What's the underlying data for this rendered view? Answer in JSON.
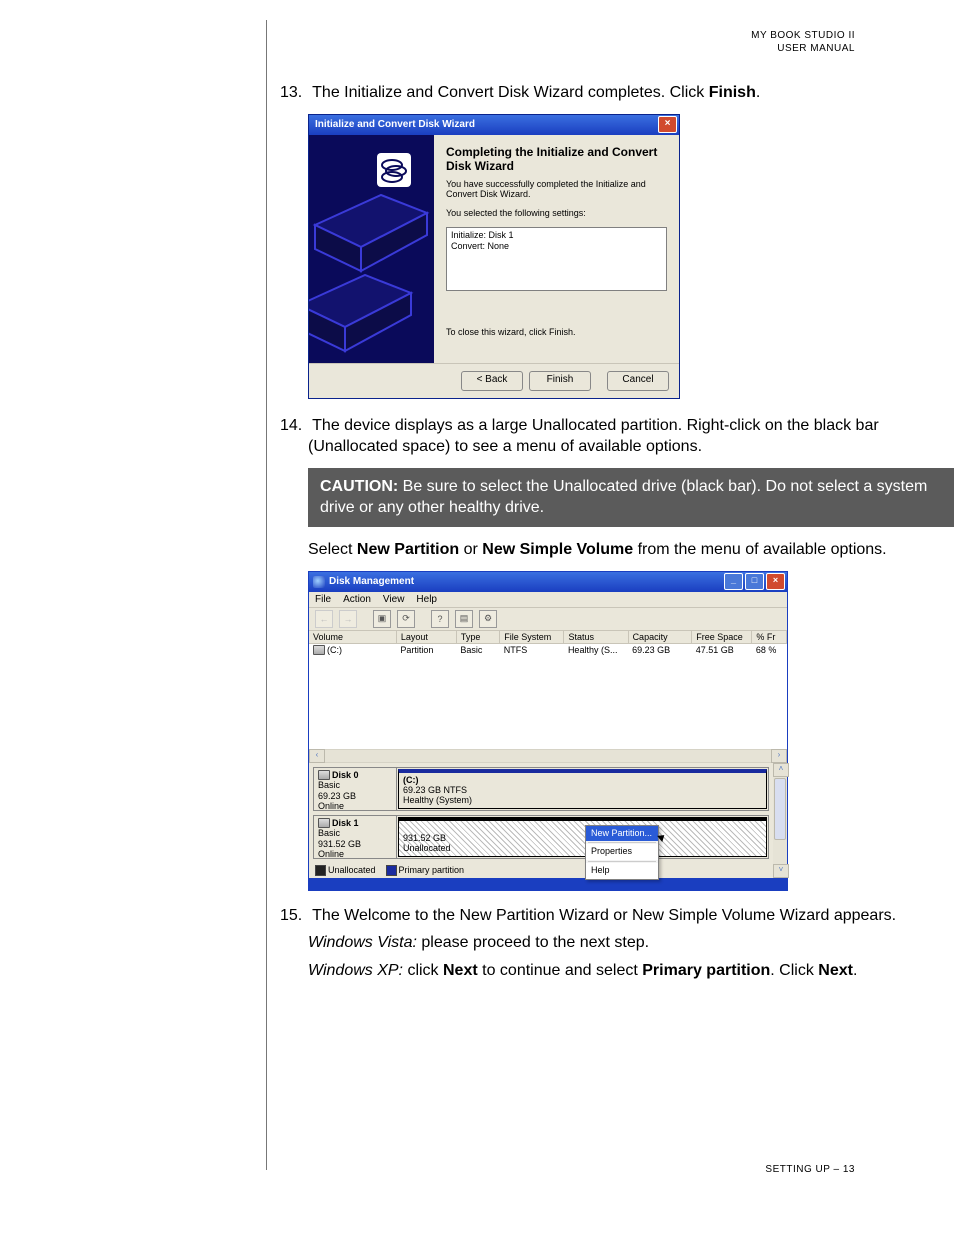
{
  "header": {
    "line1": "MY BOOK STUDIO II",
    "line2": "USER MANUAL"
  },
  "footer": "SETTING UP – 13",
  "steps": {
    "s13": {
      "num": "13.",
      "text_a": "The Initialize and Convert Disk Wizard completes. Click ",
      "text_bold": "Finish",
      "text_b": "."
    },
    "s14": {
      "num": "14.",
      "text": "The device displays as a large Unallocated partition. Right-click on the black bar (Unallocated space) to see a menu of available options."
    },
    "s14b": {
      "pre": "Select ",
      "bold1": "New Partition",
      "mid": " or ",
      "bold2": "New Simple Volume",
      "post": " from the menu of available options."
    },
    "s15": {
      "num": "15.",
      "text": "The Welcome to the New Partition Wizard or New Simple Volume Wizard appears.",
      "vista_em": "Windows Vista:",
      "vista_rest": " please proceed to the next step.",
      "xp_em": "Windows XP:",
      "xp_a": " click ",
      "xp_bold1": "Next",
      "xp_b": " to continue and select ",
      "xp_bold2": "Primary partition",
      "xp_c": ". Click ",
      "xp_bold3": "Next",
      "xp_d": "."
    }
  },
  "caution": {
    "label": "CAUTION:",
    "text": " Be sure to select the Unallocated drive (black bar). Do not select a system drive or any other healthy drive."
  },
  "wizard": {
    "title": "Initialize and Convert Disk Wizard",
    "h": "Completing the Initialize and Convert Disk Wizard",
    "p1": "You have successfully completed the Initialize and Convert Disk Wizard.",
    "p2": "You selected the following settings:",
    "settings": {
      "l1": "Initialize: Disk 1",
      "l2": "Convert: None"
    },
    "p3": "To close this wizard, click Finish.",
    "buttons": {
      "back": "< Back",
      "finish": "Finish",
      "cancel": "Cancel"
    }
  },
  "dm": {
    "title": "Disk Management",
    "menu": [
      "File",
      "Action",
      "View",
      "Help"
    ],
    "columns": [
      "Volume",
      "Layout",
      "Type",
      "File System",
      "Status",
      "Capacity",
      "Free Space",
      "% Fr"
    ],
    "row": {
      "volume": "(C:)",
      "layout": "Partition",
      "type": "Basic",
      "fs": "NTFS",
      "status": "Healthy (S...",
      "capacity": "69.23 GB",
      "free": "47.51 GB",
      "pct": "68 %"
    },
    "disk0": {
      "name": "Disk 0",
      "type": "Basic",
      "size": "69.23 GB",
      "state": "Online",
      "part_label": "(C:)",
      "part_line2": "69.23 GB NTFS",
      "part_line3": "Healthy (System)"
    },
    "disk1": {
      "name": "Disk 1",
      "type": "Basic",
      "size": "931.52 GB",
      "state": "Online",
      "part_line2": "931.52 GB",
      "part_line3": "Unallocated"
    },
    "legend": {
      "unalloc": "Unallocated",
      "primary": "Primary partition"
    },
    "context": {
      "new_partition": "New Partition...",
      "properties": "Properties",
      "help": "Help"
    }
  }
}
